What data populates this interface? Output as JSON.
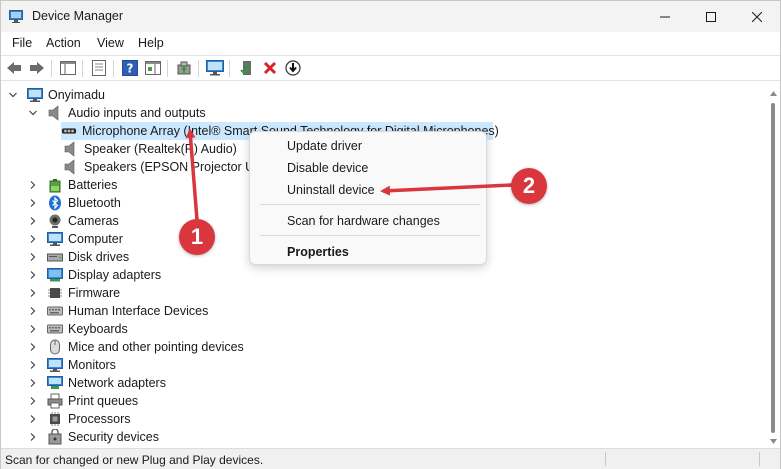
{
  "window": {
    "title": "Device Manager"
  },
  "menu": [
    "File",
    "Action",
    "View",
    "Help"
  ],
  "tree": {
    "root": "Onyimadu",
    "audio_category": "Audio inputs and outputs",
    "audio_children": [
      "Microphone Array (Intel® Smart Sound Technology for Digital Microphones)",
      "Speaker (Realtek(R) Audio)",
      "Speakers (EPSON Projector UD ..."
    ],
    "categories": [
      {
        "label": "Batteries",
        "icon": "battery-icon"
      },
      {
        "label": "Bluetooth",
        "icon": "bluetooth-icon"
      },
      {
        "label": "Cameras",
        "icon": "camera-icon"
      },
      {
        "label": "Computer",
        "icon": "computer-icon"
      },
      {
        "label": "Disk drives",
        "icon": "disk-drive-icon"
      },
      {
        "label": "Display adapters",
        "icon": "display-adapter-icon"
      },
      {
        "label": "Firmware",
        "icon": "firmware-icon"
      },
      {
        "label": "Human Interface Devices",
        "icon": "hid-icon"
      },
      {
        "label": "Keyboards",
        "icon": "keyboard-icon"
      },
      {
        "label": "Mice and other pointing devices",
        "icon": "mouse-icon"
      },
      {
        "label": "Monitors",
        "icon": "monitor-icon"
      },
      {
        "label": "Network adapters",
        "icon": "network-adapter-icon"
      },
      {
        "label": "Print queues",
        "icon": "printer-icon"
      },
      {
        "label": "Processors",
        "icon": "processor-icon"
      },
      {
        "label": "Security devices",
        "icon": "security-device-icon"
      }
    ]
  },
  "context_menu": {
    "update": "Update driver",
    "disable": "Disable device",
    "uninstall": "Uninstall device",
    "scan": "Scan for hardware changes",
    "properties": "Properties"
  },
  "status": {
    "text": "Scan for changed or new Plug and Play devices."
  },
  "annotations": {
    "badge1": "1",
    "badge2": "2",
    "color": "#d9363e"
  },
  "colors": {
    "selection": "#cce8ff",
    "accent": "#0078d4"
  }
}
